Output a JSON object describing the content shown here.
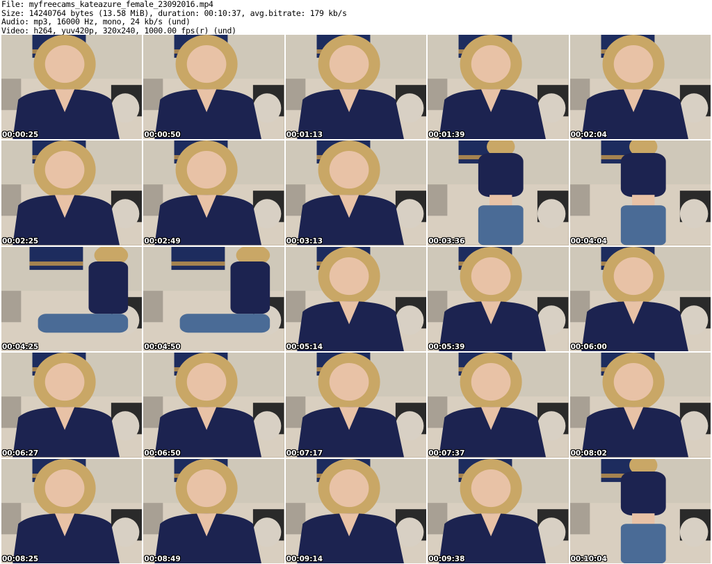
{
  "header": {
    "file_line": "File: myfreecams_kateazure_female_23092016.mp4",
    "size_line": "Size: 14240764 bytes (13.58 MiB), duration: 00:10:37, avg.bitrate: 179 kb/s",
    "audio_line": "Audio: mp3, 16000 Hz, mono, 24 kb/s (und)",
    "video_line": "Video: h264, yuv420p, 320x240, 1000.00 fps(r) (und)"
  },
  "colors": {
    "wall": "#cfc8b9",
    "shirt": "#1c2350",
    "hair": "#c9a766",
    "skin": "#e8c2a6",
    "sofa": "#d9cfc0",
    "poster": "#1d2c5e",
    "jeans": "#4a6b96"
  },
  "thumbnails": [
    {
      "timestamp": "00:00:25",
      "pose": "seated"
    },
    {
      "timestamp": "00:00:50",
      "pose": "seated"
    },
    {
      "timestamp": "00:01:13",
      "pose": "seated"
    },
    {
      "timestamp": "00:01:39",
      "pose": "seated"
    },
    {
      "timestamp": "00:02:04",
      "pose": "seated"
    },
    {
      "timestamp": "00:02:25",
      "pose": "seated"
    },
    {
      "timestamp": "00:02:49",
      "pose": "seated"
    },
    {
      "timestamp": "00:03:13",
      "pose": "seated"
    },
    {
      "timestamp": "00:03:36",
      "pose": "standing"
    },
    {
      "timestamp": "00:04:04",
      "pose": "standing"
    },
    {
      "timestamp": "00:04:25",
      "pose": "side"
    },
    {
      "timestamp": "00:04:50",
      "pose": "side"
    },
    {
      "timestamp": "00:05:14",
      "pose": "seated"
    },
    {
      "timestamp": "00:05:39",
      "pose": "seated"
    },
    {
      "timestamp": "00:06:00",
      "pose": "seated"
    },
    {
      "timestamp": "00:06:27",
      "pose": "seated"
    },
    {
      "timestamp": "00:06:50",
      "pose": "seated"
    },
    {
      "timestamp": "00:07:17",
      "pose": "seated"
    },
    {
      "timestamp": "00:07:37",
      "pose": "seated"
    },
    {
      "timestamp": "00:08:02",
      "pose": "seated"
    },
    {
      "timestamp": "00:08:25",
      "pose": "seated"
    },
    {
      "timestamp": "00:08:49",
      "pose": "seated"
    },
    {
      "timestamp": "00:09:14",
      "pose": "seated"
    },
    {
      "timestamp": "00:09:38",
      "pose": "seated"
    },
    {
      "timestamp": "00:10:04",
      "pose": "standing"
    }
  ]
}
